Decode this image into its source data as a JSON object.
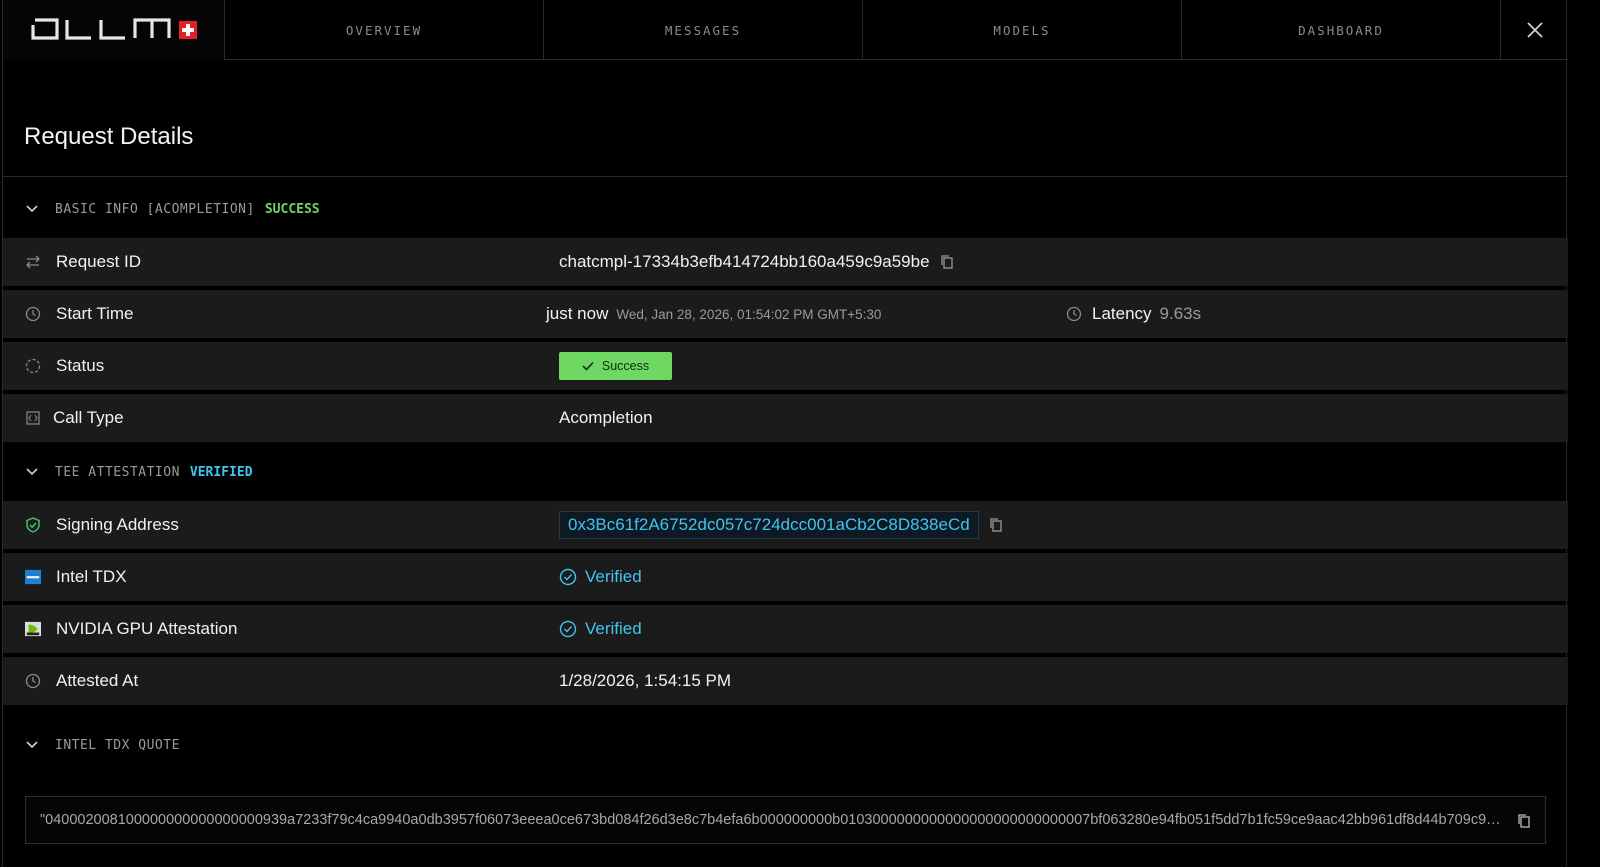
{
  "brand": {
    "logo_text": "OLLM",
    "flag": "swiss-cross"
  },
  "nav": {
    "tabs": [
      {
        "label": "OVERVIEW"
      },
      {
        "label": "MESSAGES"
      },
      {
        "label": "MODELS"
      },
      {
        "label": "DASHBOARD"
      }
    ],
    "x_icon": "x-logo-icon"
  },
  "page": {
    "title": "Request Details"
  },
  "basic_info": {
    "label": "BASIC INFO [ACOMPLETION]",
    "status": "SUCCESS",
    "status_color": "#6ed863",
    "rows": {
      "request_id": {
        "label": "Request ID",
        "value": "chatcmpl-17334b3efb414724bb160a459c9a59be"
      },
      "start_time": {
        "label": "Start Time",
        "relative": "just now",
        "absolute": "Wed, Jan 28, 2026, 01:54:02 PM GMT+5:30",
        "latency_label": "Latency",
        "latency_value": "9.63s"
      },
      "status": {
        "label": "Status",
        "badge": "Success"
      },
      "call_type": {
        "label": "Call Type",
        "value": "Acompletion"
      }
    }
  },
  "tee": {
    "label": "TEE ATTESTATION",
    "status": "VERIFIED",
    "status_color": "#3fc4f0",
    "rows": {
      "signing_address": {
        "label": "Signing Address",
        "value": "0x3Bc61f2A6752dc057c724dcc001aCb2C8D838eCd"
      },
      "intel_tdx": {
        "label": "Intel TDX",
        "value": "Verified"
      },
      "nvidia": {
        "label": "NVIDIA GPU Attestation",
        "value": "Verified"
      },
      "attested_at": {
        "label": "Attested At",
        "value": "1/28/2026, 1:54:15 PM"
      }
    }
  },
  "tdx_quote": {
    "label": "INTEL TDX QUOTE",
    "value": "\"040002008100000000000000000939a7233f79c4ca9940a0db3957f06073eeea0ce673bd084f26d3e8c7b4efa6b000000000b0103000000000000000000000000007bf063280e94fb051f5dd7b1fc59ce9aac42bb961df8d44b709c9b0f..."
  }
}
